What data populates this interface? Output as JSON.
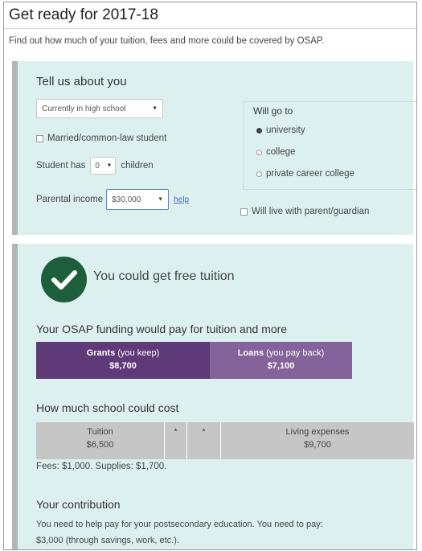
{
  "header": {
    "title": "Get ready for 2017-18",
    "subtitle": "Find out how much of your tuition, fees and more could be covered by OSAP."
  },
  "about": {
    "heading": "Tell us about you",
    "status_select": "Currently in high school",
    "married_label": "Married/common-law student",
    "children_prefix": "Student has",
    "children_value": "0",
    "children_suffix": "children",
    "income_label": "Parental income",
    "income_value": "$30,000",
    "help_link": "help",
    "will_go": {
      "heading": "Will go to",
      "options": [
        "university",
        "college",
        "private career college"
      ],
      "selected": "university"
    },
    "live_with_parent_label": "Will live with parent/guardian"
  },
  "result": {
    "message": "You could get free tuition",
    "funding_heading": "Your OSAP funding would pay for tuition and more",
    "grants": {
      "label": "Grants",
      "note": "(you keep)",
      "amount": "$8,700",
      "color": "#5e3a78"
    },
    "loans": {
      "label": "Loans",
      "note": "(you pay back)",
      "amount": "$7,100",
      "color": "#84639a"
    },
    "cost_heading": "How much school could cost",
    "costs": {
      "tuition_label": "Tuition",
      "tuition_amount": "$6,500",
      "mark1": "*",
      "mark2": "*",
      "living_label": "Living expenses",
      "living_amount": "$9,700"
    },
    "fees_note": "Fees: $1,000. Supplies: $1,700.",
    "contribution_heading": "Your contribution",
    "contribution_line1": "You need to help pay for your postsecondary education. You need to pay:",
    "contribution_line2": "$3,000 (through savings, work, etc.)."
  }
}
